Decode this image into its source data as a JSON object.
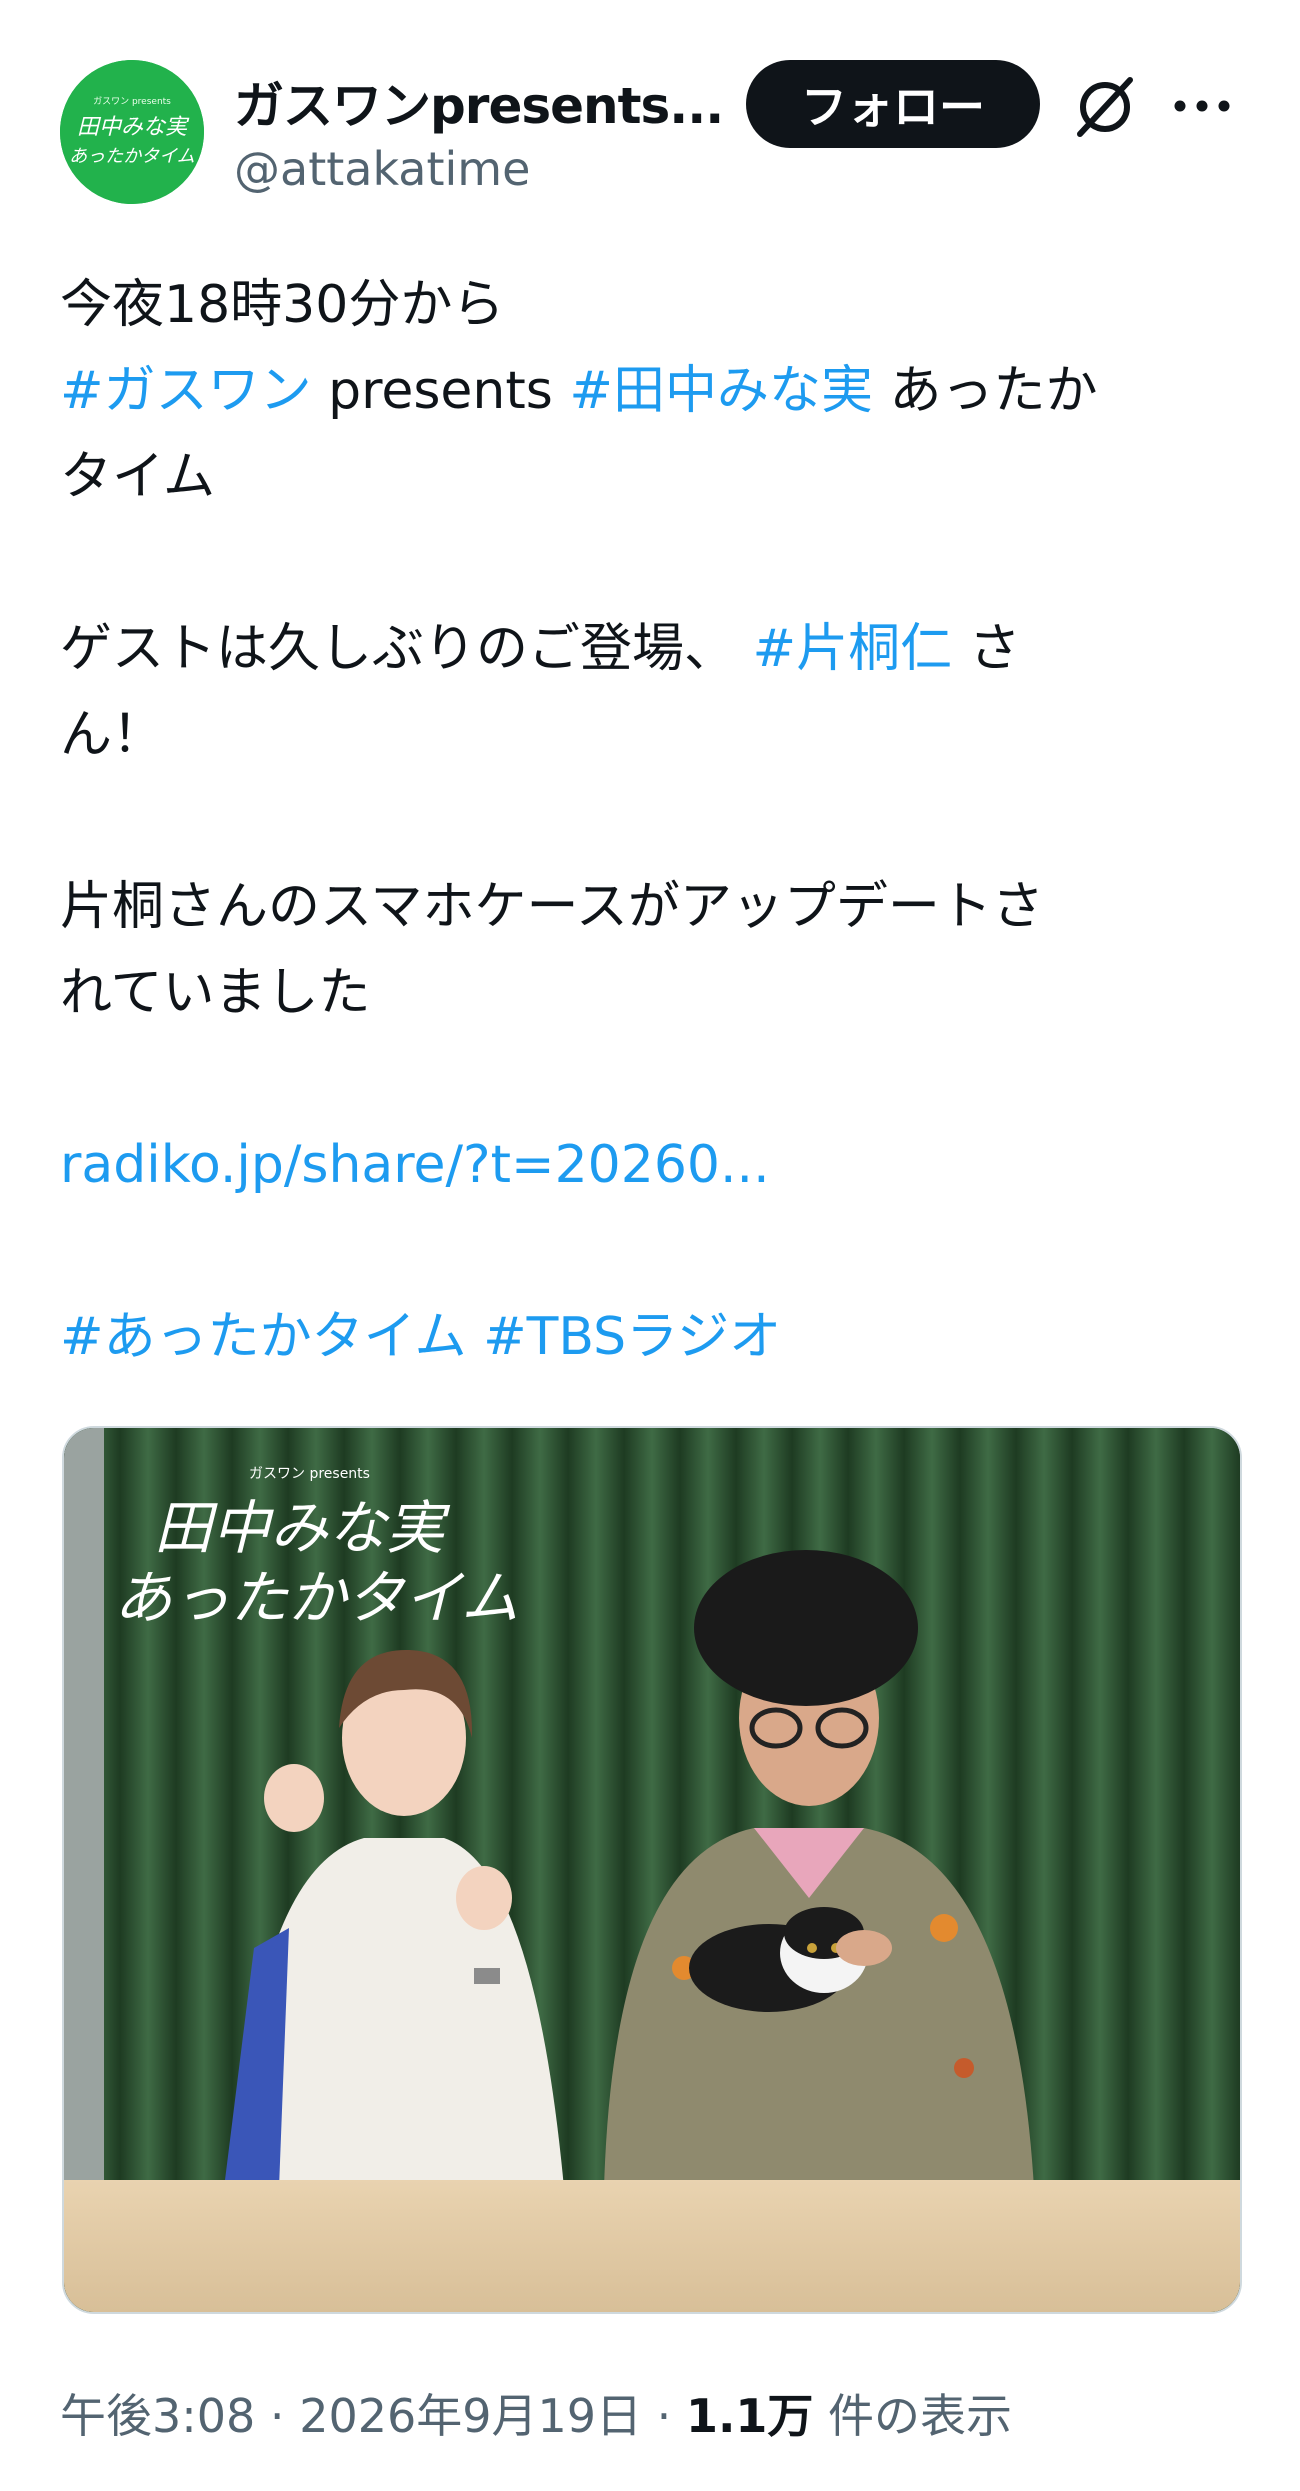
{
  "account": {
    "display_name": "ガスワンpresents...",
    "handle": "@attakatime",
    "avatar_text_top": "ガスワン presents",
    "avatar_text_line1": "田中みな実",
    "avatar_text_line2": "あったかタイム",
    "avatar_color": "#22b24c"
  },
  "actions": {
    "follow_label": "フォロー",
    "grok_icon": "grok-icon",
    "more_icon": "more-icon"
  },
  "tweet": {
    "line1": "今夜18時30分から",
    "line2_tag1": "#ガスワン",
    "line2_text": " presents ",
    "line2_tag2": "#田中みな実",
    "line2_tail": " あったか",
    "line3": "タイム",
    "line4_text": "ゲストは久しぶりのご登場、 ",
    "line4_tag": "#片桐仁",
    "line4_tail": " さ",
    "line5": "ん！",
    "line6": "片桐さんのスマホケースがアップデートさ",
    "line7": "れていました",
    "link": "radiko.jp/share/?t=20260...",
    "tag_a": "#あったかタイム",
    "tag_b": "#TBSラジオ",
    "hashtag_color": "#1d9bf0"
  },
  "media": {
    "overlay_small": "ガスワン presents",
    "overlay_line1": "田中みな実",
    "overlay_line2": "あったかタイム"
  },
  "meta": {
    "time": "午後3:08",
    "sep1": " · ",
    "date": "2026年9月19日",
    "sep2": " · ",
    "views_count": "1.1万",
    "views_label": " 件の表示"
  }
}
